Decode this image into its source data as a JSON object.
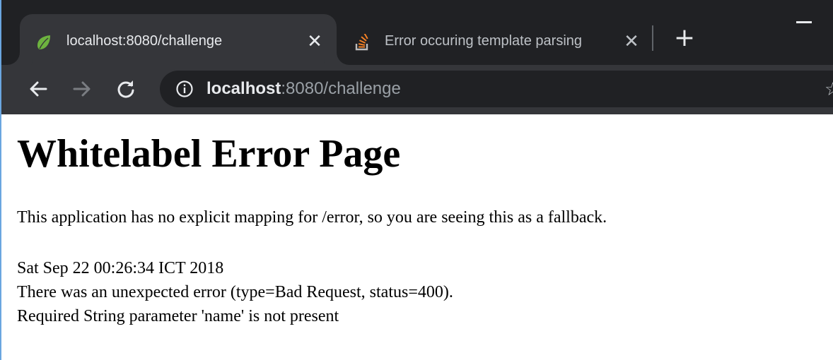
{
  "tabs": [
    {
      "title": "localhost:8080/challenge",
      "favicon": "spring-leaf-icon",
      "active": true,
      "close": "✕"
    },
    {
      "title": "Error occuring template parsing",
      "favicon": "stackoverflow-icon",
      "active": false,
      "close": "✕"
    }
  ],
  "new_tab_glyph": "+",
  "toolbar": {
    "back_icon": "arrow-left-icon",
    "forward_icon": "arrow-right-icon",
    "reload_icon": "reload-icon",
    "url_host": "localhost",
    "url_rest": ":8080/challenge",
    "info_icon": "info-icon"
  },
  "page": {
    "heading": "Whitelabel Error Page",
    "intro": "This application has no explicit mapping for /error, so you are seeing this as a fallback.",
    "timestamp": "Sat Sep 22 00:26:34 ICT 2018",
    "error_line": "There was an unexpected error (type=Bad Request, status=400).",
    "message": "Required String parameter 'name' is not present"
  },
  "colors": {
    "chrome_dark": "#202124",
    "chrome_tab": "#35363a",
    "spring_green": "#6db33f",
    "stackoverflow_orange": "#f48024",
    "window_border": "#6aa6e0"
  }
}
